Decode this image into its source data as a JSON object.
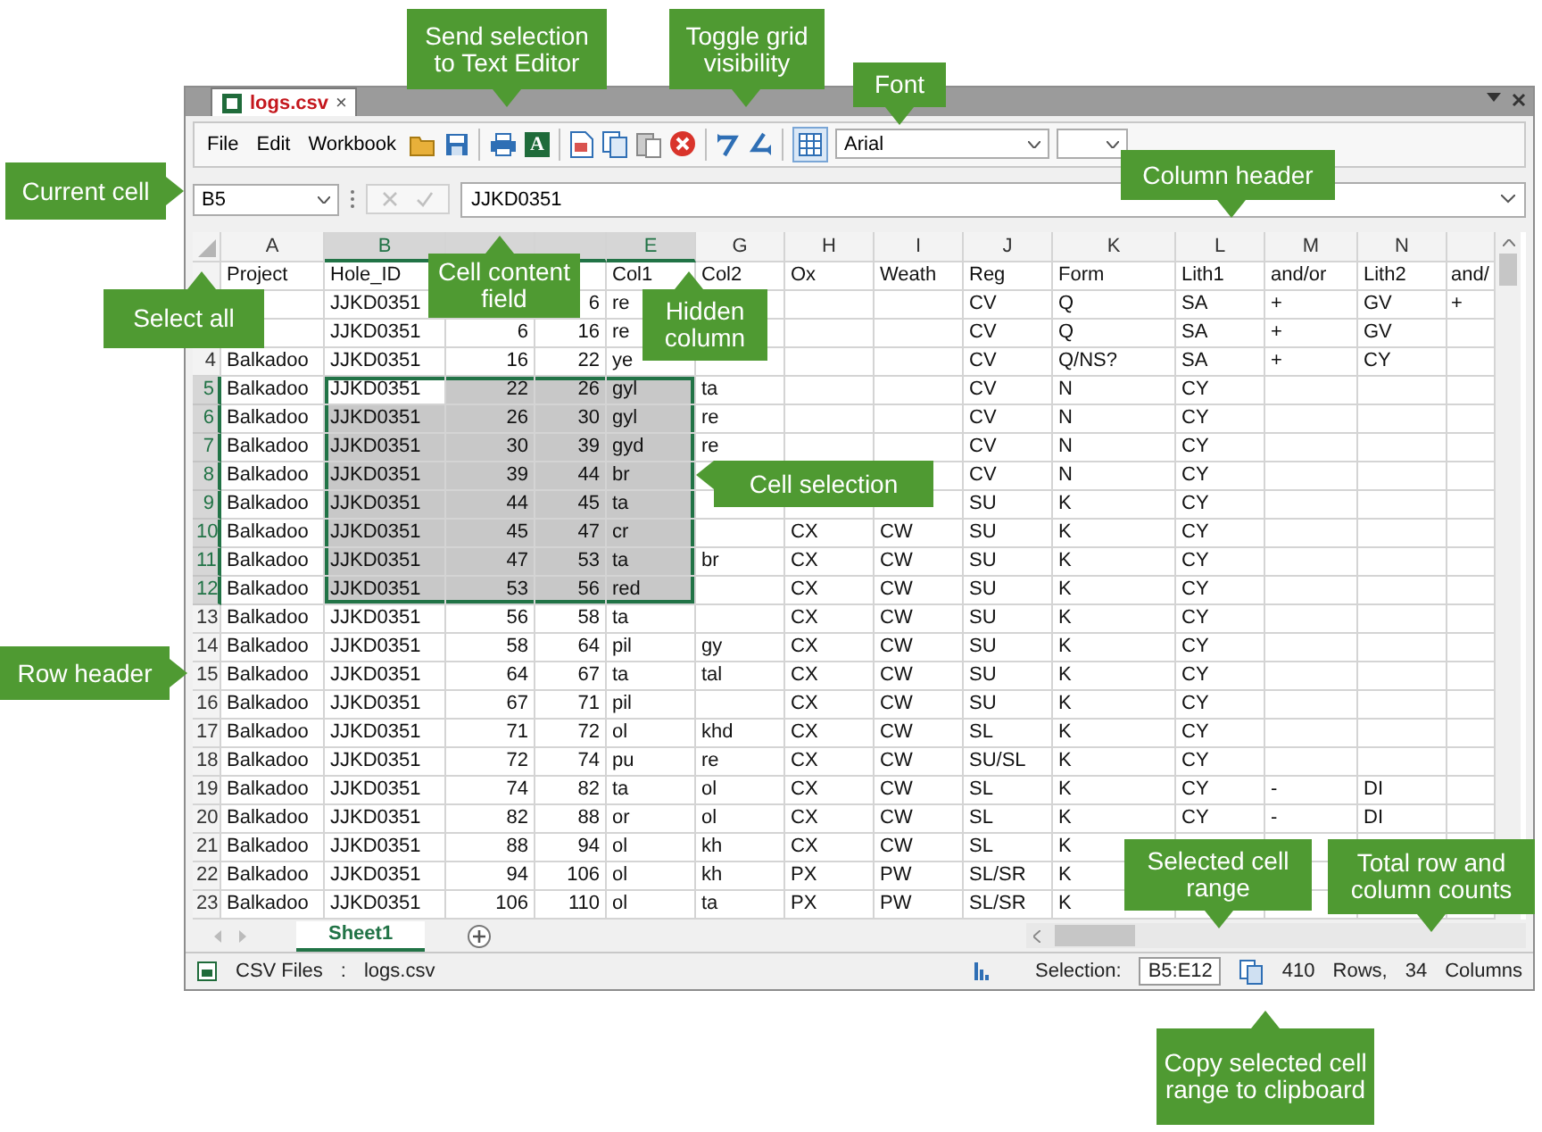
{
  "document_tab": {
    "title": "logs.csv",
    "close": "×"
  },
  "menu": [
    "File",
    "Edit",
    "Workbook"
  ],
  "toolbar": [
    {
      "kind": "open"
    },
    {
      "kind": "save"
    },
    {
      "kind": "separator"
    },
    {
      "kind": "print"
    },
    {
      "kind": "text-editor",
      "glyph": "A"
    },
    {
      "kind": "separator"
    },
    {
      "kind": "cut"
    },
    {
      "kind": "copy"
    },
    {
      "kind": "paste"
    },
    {
      "kind": "delete"
    },
    {
      "kind": "separator"
    },
    {
      "kind": "undo"
    },
    {
      "kind": "redo"
    },
    {
      "kind": "separator"
    },
    {
      "kind": "grid",
      "on": true
    }
  ],
  "font": {
    "family": "Arial"
  },
  "formula_bar": {
    "cell": "B5",
    "actions_disabled": true,
    "value": "JJKD0351"
  },
  "table": {
    "columns": [
      {
        "label": "A",
        "selected": false,
        "kind": "text"
      },
      {
        "label": "B",
        "selected": true,
        "kind": "text"
      },
      {
        "selected": true,
        "kind": "number"
      },
      {
        "selected": true,
        "kind": "number"
      },
      {
        "label": "E",
        "selected": true,
        "kind": "text"
      },
      {
        "label": "G",
        "selected": false,
        "kind": "text"
      },
      {
        "label": "H",
        "selected": false,
        "kind": "text"
      },
      {
        "label": "I",
        "selected": false,
        "kind": "text"
      },
      {
        "label": "J",
        "selected": false,
        "kind": "text"
      },
      {
        "label": "K",
        "selected": false,
        "kind": "text"
      },
      {
        "label": "L",
        "selected": false,
        "kind": "text"
      },
      {
        "label": "M",
        "selected": false,
        "kind": "text"
      },
      {
        "label": "N",
        "selected": false,
        "kind": "text"
      },
      {
        "selected": false,
        "kind": "text"
      }
    ],
    "rows": [
      {
        "header": null,
        "selected": false,
        "cells": [
          "Project",
          "Hole_ID",
          null,
          null,
          "Col1",
          "Col2",
          "Ox",
          "Weath",
          "Reg",
          "Form",
          "Lith1",
          "and/or",
          "Lith2",
          "and/"
        ]
      },
      {
        "header": null,
        "selected": false,
        "cells": [
          null,
          "JJKD0351",
          null,
          "6",
          "re",
          null,
          null,
          null,
          "CV",
          "Q",
          "SA",
          "+",
          "GV",
          "+"
        ]
      },
      {
        "header": null,
        "selected": false,
        "cells": [
          null,
          "JJKD0351",
          "6",
          "16",
          "re",
          null,
          null,
          null,
          "CV",
          "Q",
          "SA",
          "+",
          "GV",
          null
        ]
      },
      {
        "header": "4",
        "selected": false,
        "cells": [
          "Balkadoo",
          "JJKD0351",
          "16",
          "22",
          "ye",
          null,
          null,
          null,
          "CV",
          "Q/NS?",
          "SA",
          "+",
          "CY",
          null
        ]
      },
      {
        "header": "5",
        "selected": true,
        "cells": [
          "Balkadoo",
          "JJKD0351",
          "22",
          "26",
          "gyl",
          "ta",
          null,
          null,
          "CV",
          "N",
          "CY",
          null,
          null,
          null
        ]
      },
      {
        "header": "6",
        "selected": true,
        "cells": [
          "Balkadoo",
          "JJKD0351",
          "26",
          "30",
          "gyl",
          "re",
          null,
          null,
          "CV",
          "N",
          "CY",
          null,
          null,
          null
        ]
      },
      {
        "header": "7",
        "selected": true,
        "cells": [
          "Balkadoo",
          "JJKD0351",
          "30",
          "39",
          "gyd",
          "re",
          null,
          null,
          "CV",
          "N",
          "CY",
          null,
          null,
          null
        ]
      },
      {
        "header": "8",
        "selected": true,
        "cells": [
          "Balkadoo",
          "JJKD0351",
          "39",
          "44",
          "br",
          null,
          null,
          null,
          "CV",
          "N",
          "CY",
          null,
          null,
          null
        ]
      },
      {
        "header": "9",
        "selected": true,
        "cells": [
          "Balkadoo",
          "JJKD0351",
          "44",
          "45",
          "ta",
          null,
          null,
          null,
          "SU",
          "K",
          "CY",
          null,
          null,
          null
        ]
      },
      {
        "header": "10",
        "selected": true,
        "cells": [
          "Balkadoo",
          "JJKD0351",
          "45",
          "47",
          "cr",
          null,
          "CX",
          "CW",
          "SU",
          "K",
          "CY",
          null,
          null,
          null
        ]
      },
      {
        "header": "11",
        "selected": true,
        "cells": [
          "Balkadoo",
          "JJKD0351",
          "47",
          "53",
          "ta",
          "br",
          "CX",
          "CW",
          "SU",
          "K",
          "CY",
          null,
          null,
          null
        ]
      },
      {
        "header": "12",
        "selected": true,
        "cells": [
          "Balkadoo",
          "JJKD0351",
          "53",
          "56",
          "red",
          null,
          "CX",
          "CW",
          "SU",
          "K",
          "CY",
          null,
          null,
          null
        ]
      },
      {
        "header": "13",
        "selected": false,
        "cells": [
          "Balkadoo",
          "JJKD0351",
          "56",
          "58",
          "ta",
          null,
          "CX",
          "CW",
          "SU",
          "K",
          "CY",
          null,
          null,
          null
        ]
      },
      {
        "header": "14",
        "selected": false,
        "cells": [
          "Balkadoo",
          "JJKD0351",
          "58",
          "64",
          "pil",
          "gy",
          "CX",
          "CW",
          "SU",
          "K",
          "CY",
          null,
          null,
          null
        ]
      },
      {
        "header": "15",
        "selected": false,
        "cells": [
          "Balkadoo",
          "JJKD0351",
          "64",
          "67",
          "ta",
          "tal",
          "CX",
          "CW",
          "SU",
          "K",
          "CY",
          null,
          null,
          null
        ]
      },
      {
        "header": "16",
        "selected": false,
        "cells": [
          "Balkadoo",
          "JJKD0351",
          "67",
          "71",
          "pil",
          null,
          "CX",
          "CW",
          "SU",
          "K",
          "CY",
          null,
          null,
          null
        ]
      },
      {
        "header": "17",
        "selected": false,
        "cells": [
          "Balkadoo",
          "JJKD0351",
          "71",
          "72",
          "ol",
          "khd",
          "CX",
          "CW",
          "SL",
          "K",
          "CY",
          null,
          null,
          null
        ]
      },
      {
        "header": "18",
        "selected": false,
        "cells": [
          "Balkadoo",
          "JJKD0351",
          "72",
          "74",
          "pu",
          "re",
          "CX",
          "CW",
          "SU/SL",
          "K",
          "CY",
          null,
          null,
          null
        ]
      },
      {
        "header": "19",
        "selected": false,
        "cells": [
          "Balkadoo",
          "JJKD0351",
          "74",
          "82",
          "ta",
          "ol",
          "CX",
          "CW",
          "SL",
          "K",
          "CY",
          "-",
          "DI",
          null
        ]
      },
      {
        "header": "20",
        "selected": false,
        "cells": [
          "Balkadoo",
          "JJKD0351",
          "82",
          "88",
          "or",
          "ol",
          "CX",
          "CW",
          "SL",
          "K",
          "CY",
          "-",
          "DI",
          null
        ]
      },
      {
        "header": "21",
        "selected": false,
        "cells": [
          "Balkadoo",
          "JJKD0351",
          "88",
          "94",
          "ol",
          "kh",
          "CX",
          "CW",
          "SL",
          "K",
          null,
          null,
          null,
          null
        ]
      },
      {
        "header": "22",
        "selected": false,
        "cells": [
          "Balkadoo",
          "JJKD0351",
          "94",
          "106",
          "ol",
          "kh",
          "PX",
          "PW",
          "SL/SR",
          "K",
          null,
          null,
          null,
          null
        ]
      },
      {
        "header": "23",
        "selected": false,
        "cells": [
          "Balkadoo",
          "JJKD0351",
          "106",
          "110",
          "ol",
          "ta",
          "PX",
          "PW",
          "SL/SR",
          "K",
          null,
          null,
          null,
          null
        ]
      }
    ]
  },
  "sheet_tabs": [
    {
      "label": "Sheet1",
      "selected": true
    }
  ],
  "status_bar": {
    "file_type": "CSV Files",
    "separator": ":",
    "file_name": "logs.csv",
    "selection_label": "Selection:",
    "selection_range": "B5:E12",
    "rows": "410",
    "rows_label": "Rows,",
    "columns": "34",
    "columns_label": "Columns"
  },
  "callouts": [
    {
      "text": "Send selection to Text Editor",
      "kind": "down"
    },
    {
      "text": "Toggle grid visibility",
      "kind": "down"
    },
    {
      "text": "Font",
      "kind": "down"
    },
    {
      "text": "Current cell",
      "kind": "right"
    },
    {
      "text": "Column header",
      "kind": "down"
    },
    {
      "text": "Cell content field",
      "kind": "up"
    },
    {
      "text": "Select all",
      "kind": "up"
    },
    {
      "text": "Hidden column",
      "kind": "up"
    },
    {
      "text": "Cell selection",
      "kind": "left"
    },
    {
      "text": "Row header",
      "kind": "right"
    },
    {
      "text": "Selected cell range",
      "kind": "down"
    },
    {
      "text": "Total row and column counts",
      "kind": "down"
    },
    {
      "text": "Copy selected cell range to clipboard",
      "kind": "up"
    }
  ]
}
